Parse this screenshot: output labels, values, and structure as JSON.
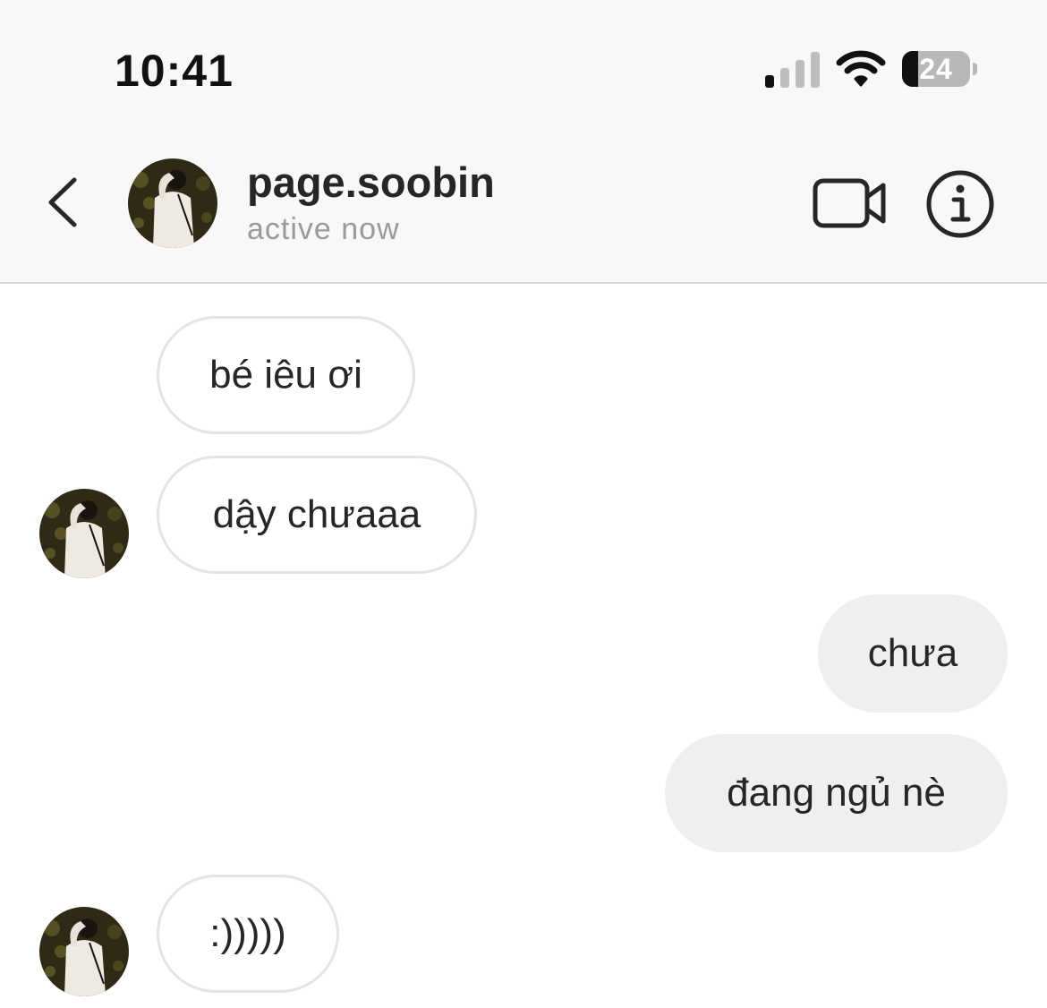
{
  "status_bar": {
    "time": "10:41",
    "battery_level": "24",
    "battery_fraction": 0.24,
    "signal_bars_active": 1,
    "signal_bars_total": 4
  },
  "header": {
    "username": "page.soobin",
    "presence": "active now",
    "icons": [
      "chevron-left-icon",
      "video-camera-icon",
      "info-icon"
    ]
  },
  "messages": [
    {
      "sender": "them",
      "text": "bé iêu ơi"
    },
    {
      "sender": "them",
      "text": "dậy chưaaa"
    },
    {
      "sender": "me",
      "text": "chưa"
    },
    {
      "sender": "me",
      "text": "đang ngủ nè"
    },
    {
      "sender": "them",
      "text": ":)))))"
    }
  ],
  "colors": {
    "header_bg": "#f8f8f8",
    "incoming_bubble_bg": "#ffffff",
    "incoming_bubble_border": "#e4e4e4",
    "outgoing_bubble_bg": "#efefef",
    "text": "#262626",
    "muted_text": "#9a9a9a"
  }
}
